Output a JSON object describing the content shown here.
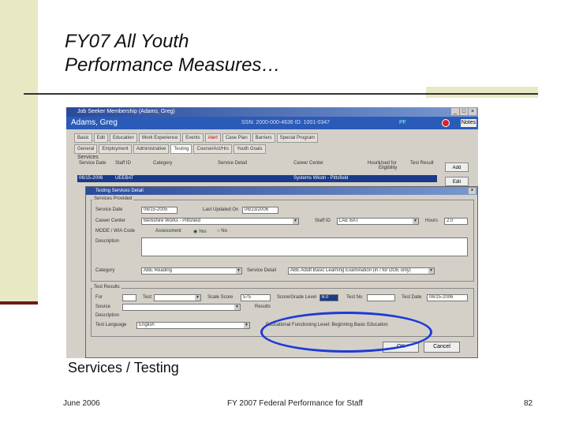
{
  "slide": {
    "title_line1": "FY07 All Youth",
    "title_line2": "Performance Measures…",
    "caption": "Services / Testing",
    "footer_date": "June 2006",
    "footer_center": "FY 2007 Federal Performance for Staff",
    "page_number": "82"
  },
  "app": {
    "window_title": "Job Seeker Membership (Adams, Greg)",
    "participant_name": "Adams, Greg",
    "header_info": "SSN: 2000-000-4636 ID: 1001-0347",
    "header_pf": "PF",
    "notes_label": "Notes",
    "tabs_row1": [
      "Basic",
      "Edit",
      "Education",
      "Work Experience",
      "Events",
      "Alert",
      "Case Plan",
      "Barriers",
      "Special Program"
    ],
    "tabs_row2": [
      "General",
      "Employment",
      "Administrative",
      "Testing",
      "Course/Act/Hrs",
      "Youth Goals"
    ],
    "active_tab": "Testing",
    "services_label": "Services",
    "columns": [
      "Service Date",
      "Staff ID",
      "Category",
      "Service Detail",
      "Career Center",
      "Hours",
      "Used for Eligibility",
      "Test Result"
    ],
    "service_row": {
      "date": "06/15-2006",
      "staff": "UEEBAT",
      "category": "",
      "detail": "",
      "center": "Systems Wkstn - Pittsfield"
    },
    "side_buttons": [
      "Add",
      "Edit"
    ]
  },
  "dialog": {
    "title": "Testing Services Detail",
    "services_provided_label": "Services Provided",
    "service_date_label": "Service Date",
    "service_date_value": "06/15-2005",
    "last_updated_label": "Last Updated On",
    "last_updated_value": "06/23/2006",
    "career_center_label": "Career Center",
    "career_center_value": "Berkshire Works - Pittsfield",
    "staff_id_label": "Staff ID",
    "staff_id_value": "LAE BAT",
    "hours_label": "Hours",
    "hours_value": "2.0",
    "wia_label": "MODE / WIA Code",
    "assessment_label": "Assessment",
    "radio_yes": "Yes",
    "radio_no": "No",
    "description_label": "Description",
    "category_label": "Category",
    "category_value": "ABE Reading",
    "service_detail_label": "Service Detail",
    "service_detail_value": "ABE Adult Basic Learning Examination (in / for DOE only)",
    "test_results_label": "Test Results",
    "for_label": "For",
    "test_label": "Test",
    "scale_score_label": "Scale Score",
    "scale_score_value": "575",
    "grade_level_label": "Score/Grade Level",
    "grade_level_value": "6.0",
    "test_no_label": "Test No",
    "test_date_label": "Test Date",
    "test_date_value": "06/15-2006",
    "source_label": "Source",
    "results_label": "Results",
    "description2_label": "Description",
    "test_language_label": "Test Language",
    "test_language_value": "English",
    "edu_level_value": "Educational Functioning Level: Beginning Basic Education",
    "ok_label": "OK",
    "cancel_label": "Cancel"
  },
  "colors": {
    "accent": "#2b5bb8",
    "annotation": "#1e3ad6",
    "title_band": "#e8e8c4"
  }
}
